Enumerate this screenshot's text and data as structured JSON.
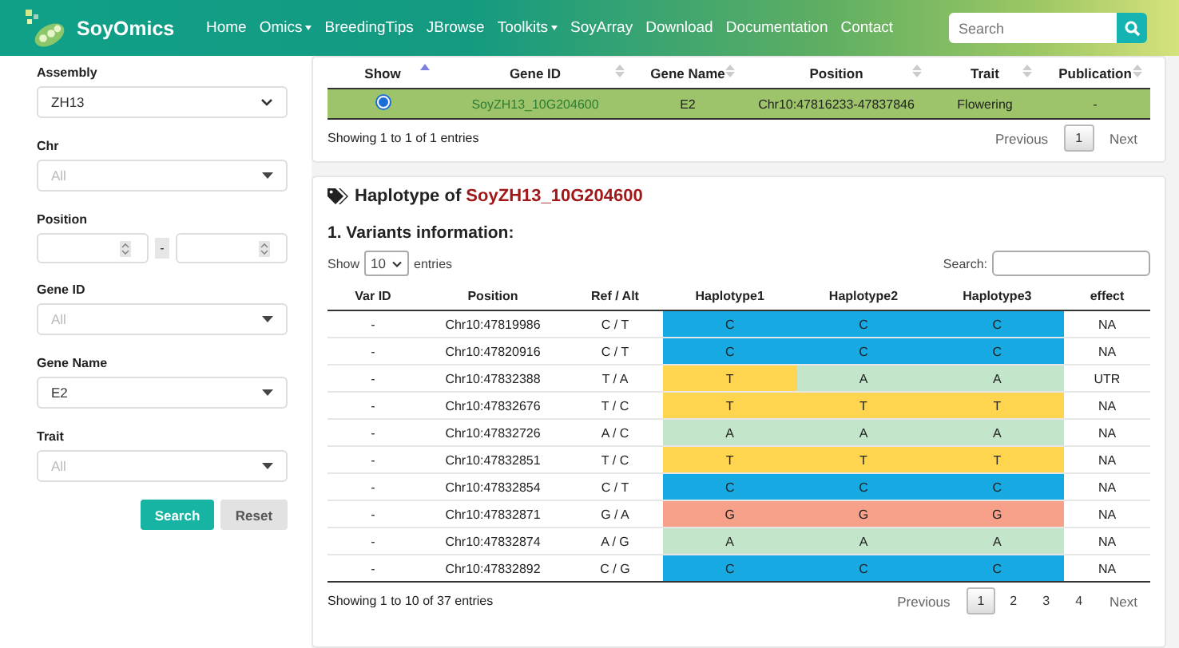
{
  "header": {
    "brand": "SoyOmics",
    "nav": [
      {
        "label": "Home",
        "dropdown": false
      },
      {
        "label": "Omics",
        "dropdown": true
      },
      {
        "label": "BreedingTips",
        "dropdown": false
      },
      {
        "label": "JBrowse",
        "dropdown": false
      },
      {
        "label": "Toolkits",
        "dropdown": true
      },
      {
        "label": "SoyArray",
        "dropdown": false
      },
      {
        "label": "Download",
        "dropdown": false
      },
      {
        "label": "Documentation",
        "dropdown": false
      },
      {
        "label": "Contact",
        "dropdown": false
      }
    ],
    "search": {
      "placeholder": "Search"
    }
  },
  "sidebar": {
    "fields": [
      {
        "kind": "select",
        "label": "Assembly",
        "value": "ZH13"
      },
      {
        "kind": "dropdown",
        "label": "Chr",
        "placeholder": "All"
      },
      {
        "kind": "range",
        "label": "Position"
      },
      {
        "kind": "dropdown",
        "label": "Gene ID",
        "placeholder": "All"
      },
      {
        "kind": "dropdown",
        "label": "Gene Name",
        "value": "E2"
      },
      {
        "kind": "dropdown",
        "label": "Trait",
        "placeholder": "All"
      }
    ],
    "range_separator": "-",
    "buttons": [
      {
        "label": "Search",
        "kind": "primary"
      },
      {
        "label": "Reset",
        "kind": "secondary"
      }
    ]
  },
  "genes_table": {
    "columns": [
      {
        "label": "Show",
        "sorted": true
      },
      {
        "label": "Gene ID",
        "sorted": false
      },
      {
        "label": "Gene Name",
        "sorted": false
      },
      {
        "label": "Position",
        "sorted": false
      },
      {
        "label": "Trait",
        "sorted": false
      },
      {
        "label": "Publication",
        "sorted": false
      }
    ],
    "rows": [
      {
        "selected": true,
        "gene_id": "SoyZH13_10G204600",
        "gene_name": "E2",
        "position": "Chr10:47816233-47837846",
        "trait": "Flowering",
        "publication": "-"
      }
    ],
    "info": "Showing 1 to 1 of 1 entries",
    "pagination": {
      "previous": "Previous",
      "next": "Next",
      "pages": [
        {
          "label": "1",
          "selected": true
        }
      ]
    }
  },
  "haplotype": {
    "title_prefix": "Haplotype of",
    "gene_id": "SoyZH13_10G204600",
    "section": "1. Variants information:",
    "length_prefix": "Show",
    "length_value": "10",
    "length_suffix": "entries",
    "search_label": "Search:",
    "columns": [
      "Var ID",
      "Position",
      "Ref / Alt",
      "Haplotype1",
      "Haplotype2",
      "Haplotype3",
      "effect"
    ],
    "rows": [
      {
        "var_id": "-",
        "position": "Chr10:47819986",
        "ref_alt": "C / T",
        "haplotypes": [
          {
            "base": "C",
            "color": "#17a9e1"
          },
          {
            "base": "C",
            "color": "#17a9e1"
          },
          {
            "base": "C",
            "color": "#17a9e1"
          }
        ],
        "effect": "NA"
      },
      {
        "var_id": "-",
        "position": "Chr10:47820916",
        "ref_alt": "C / T",
        "haplotypes": [
          {
            "base": "C",
            "color": "#17a9e1"
          },
          {
            "base": "C",
            "color": "#17a9e1"
          },
          {
            "base": "C",
            "color": "#17a9e1"
          }
        ],
        "effect": "NA"
      },
      {
        "var_id": "-",
        "position": "Chr10:47832388",
        "ref_alt": "T / A",
        "haplotypes": [
          {
            "base": "T",
            "color": "#ffd54f"
          },
          {
            "base": "A",
            "color": "#c3e6cb"
          },
          {
            "base": "A",
            "color": "#c3e6cb"
          }
        ],
        "effect": "UTR"
      },
      {
        "var_id": "-",
        "position": "Chr10:47832676",
        "ref_alt": "T / C",
        "haplotypes": [
          {
            "base": "T",
            "color": "#ffd54f"
          },
          {
            "base": "T",
            "color": "#ffd54f"
          },
          {
            "base": "T",
            "color": "#ffd54f"
          }
        ],
        "effect": "NA"
      },
      {
        "var_id": "-",
        "position": "Chr10:47832726",
        "ref_alt": "A / C",
        "haplotypes": [
          {
            "base": "A",
            "color": "#c3e6cb"
          },
          {
            "base": "A",
            "color": "#c3e6cb"
          },
          {
            "base": "A",
            "color": "#c3e6cb"
          }
        ],
        "effect": "NA"
      },
      {
        "var_id": "-",
        "position": "Chr10:47832851",
        "ref_alt": "T / C",
        "haplotypes": [
          {
            "base": "T",
            "color": "#ffd54f"
          },
          {
            "base": "T",
            "color": "#ffd54f"
          },
          {
            "base": "T",
            "color": "#ffd54f"
          }
        ],
        "effect": "NA"
      },
      {
        "var_id": "-",
        "position": "Chr10:47832854",
        "ref_alt": "C / T",
        "haplotypes": [
          {
            "base": "C",
            "color": "#17a9e1"
          },
          {
            "base": "C",
            "color": "#17a9e1"
          },
          {
            "base": "C",
            "color": "#17a9e1"
          }
        ],
        "effect": "NA"
      },
      {
        "var_id": "-",
        "position": "Chr10:47832871",
        "ref_alt": "G / A",
        "haplotypes": [
          {
            "base": "G",
            "color": "#f8a18a"
          },
          {
            "base": "G",
            "color": "#f8a18a"
          },
          {
            "base": "G",
            "color": "#f8a18a"
          }
        ],
        "effect": "NA"
      },
      {
        "var_id": "-",
        "position": "Chr10:47832874",
        "ref_alt": "A / G",
        "haplotypes": [
          {
            "base": "A",
            "color": "#c3e6cb"
          },
          {
            "base": "A",
            "color": "#c3e6cb"
          },
          {
            "base": "A",
            "color": "#c3e6cb"
          }
        ],
        "effect": "NA"
      },
      {
        "var_id": "-",
        "position": "Chr10:47832892",
        "ref_alt": "C / G",
        "haplotypes": [
          {
            "base": "C",
            "color": "#17a9e1"
          },
          {
            "base": "C",
            "color": "#17a9e1"
          },
          {
            "base": "C",
            "color": "#17a9e1"
          }
        ],
        "effect": "NA"
      }
    ],
    "info": "Showing 1 to 10 of 37 entries",
    "pagination": {
      "previous": "Previous",
      "next": "Next",
      "pages": [
        {
          "label": "1",
          "selected": true
        },
        {
          "label": "2",
          "selected": false
        },
        {
          "label": "3",
          "selected": false
        },
        {
          "label": "4",
          "selected": false
        }
      ]
    }
  }
}
